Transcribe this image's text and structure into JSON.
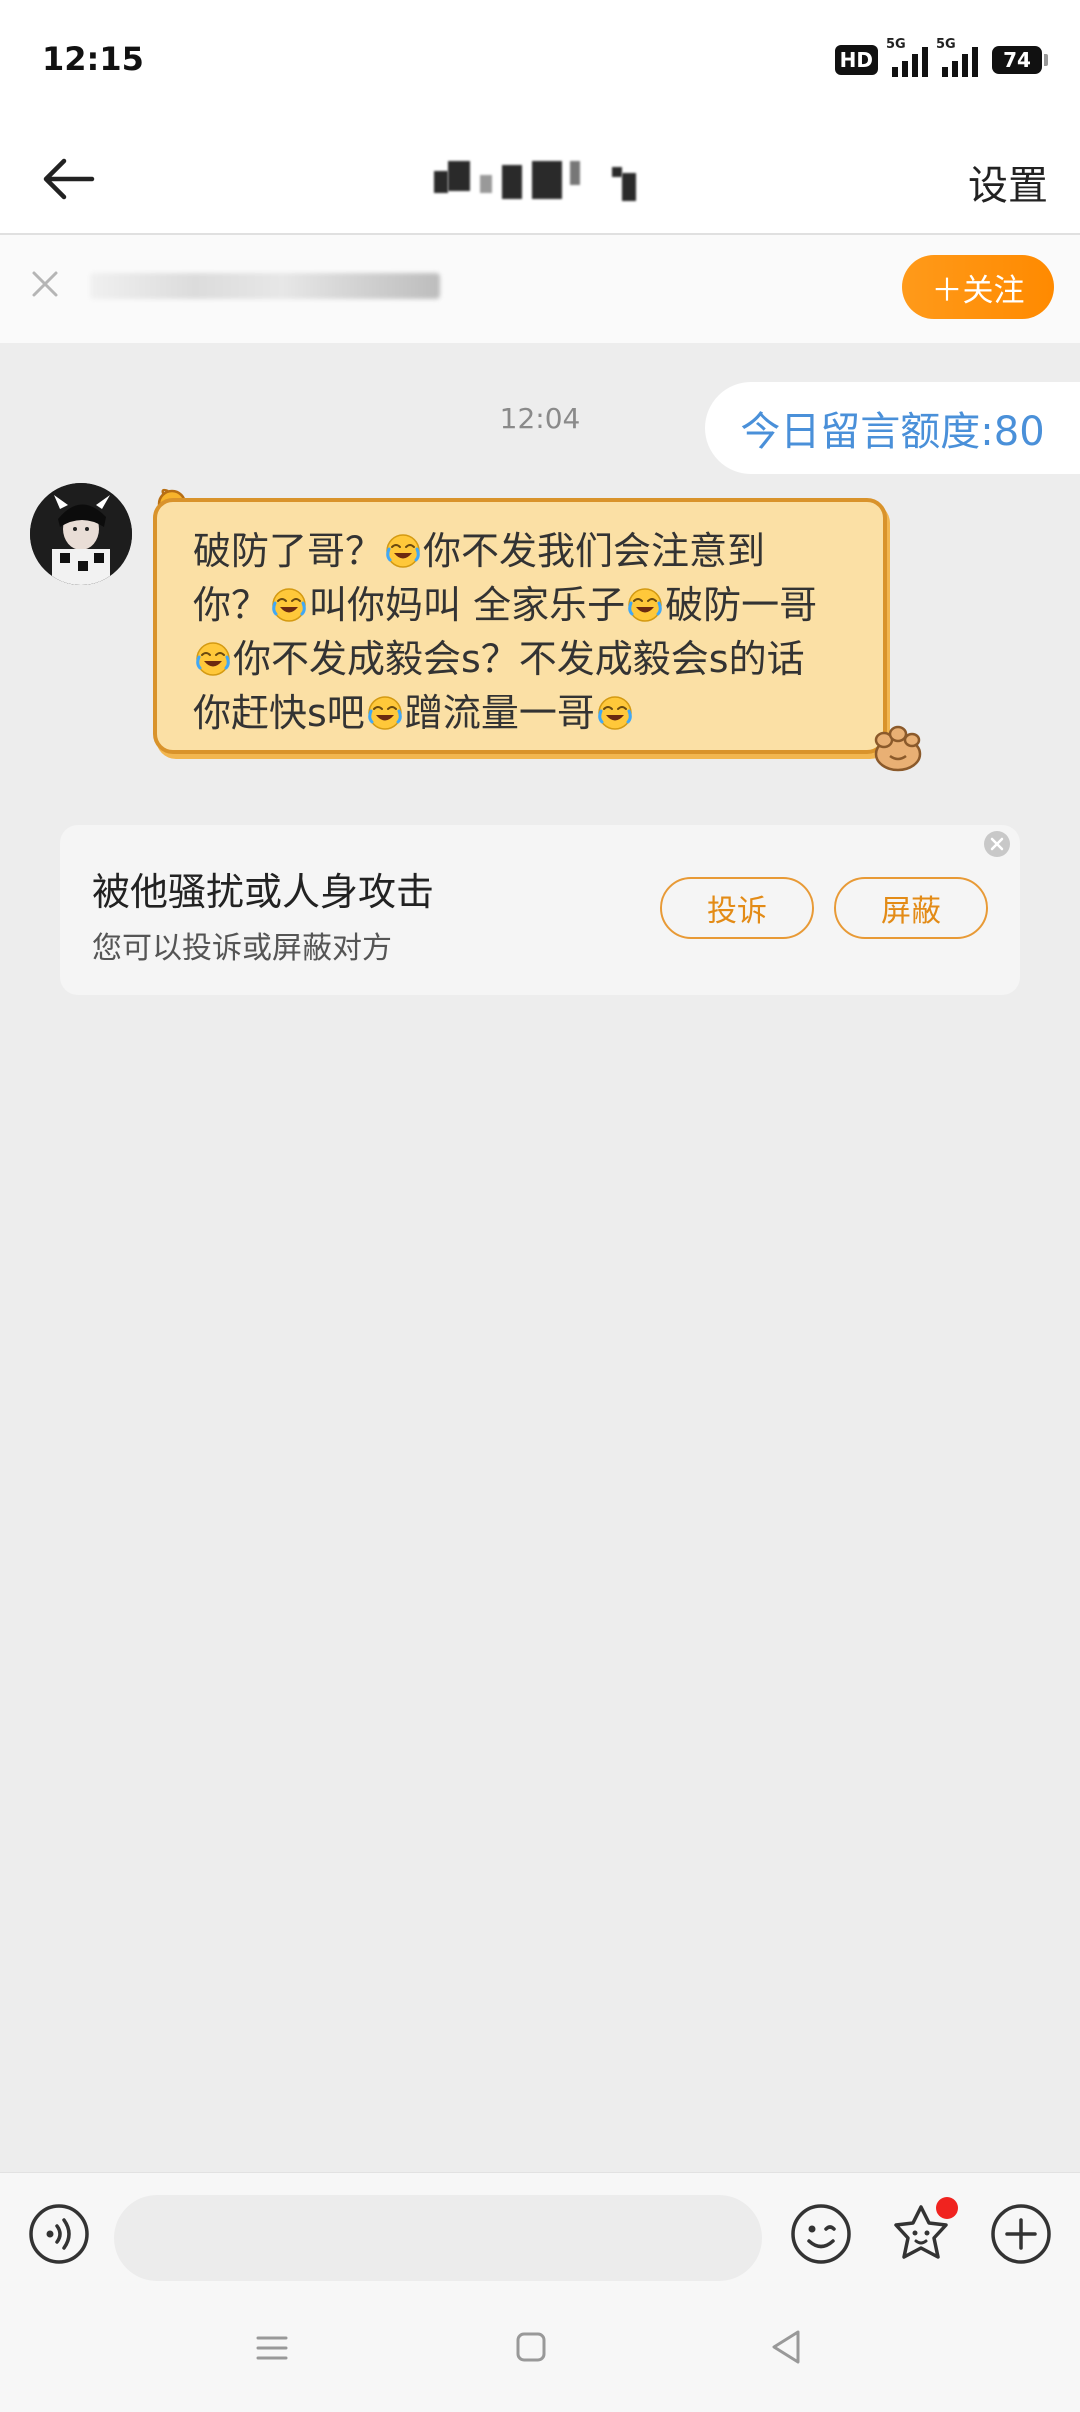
{
  "status_bar": {
    "time": "12:15",
    "hd": "HD",
    "battery": "74",
    "network": [
      "5G",
      "5G"
    ]
  },
  "title_bar": {
    "settings_label": "设置"
  },
  "follow_bar": {
    "follow_label": "＋关注"
  },
  "quota": {
    "text": "今日留言额度:80"
  },
  "conversation": {
    "timestamp": "12:04",
    "message": {
      "lines": [
        [
          "破防了哥？",
          "emoji",
          "你不发我们会注意到"
        ],
        [
          "你？",
          "emoji",
          "叫你妈叫 全家乐子",
          "emoji",
          "破防一哥"
        ],
        [
          "emoji",
          "你不发成毅会s？不发成毅会s的话"
        ],
        [
          "你赶快s吧",
          "emoji",
          "蹭流量一哥",
          "emoji"
        ]
      ],
      "emoji_name": "rofl-emoji"
    }
  },
  "report_card": {
    "title": "被他骚扰或人身攻击",
    "subtitle": "您可以投诉或屏蔽对方",
    "report_label": "投诉",
    "block_label": "屏蔽"
  },
  "input_bar": {
    "placeholder": ""
  },
  "colors": {
    "accent_orange": "#ff8a00",
    "bubble_fill": "#fbe0a5",
    "bubble_border": "#d9932b",
    "quota_blue": "#4a90d9",
    "badge_red": "#f0231f"
  }
}
